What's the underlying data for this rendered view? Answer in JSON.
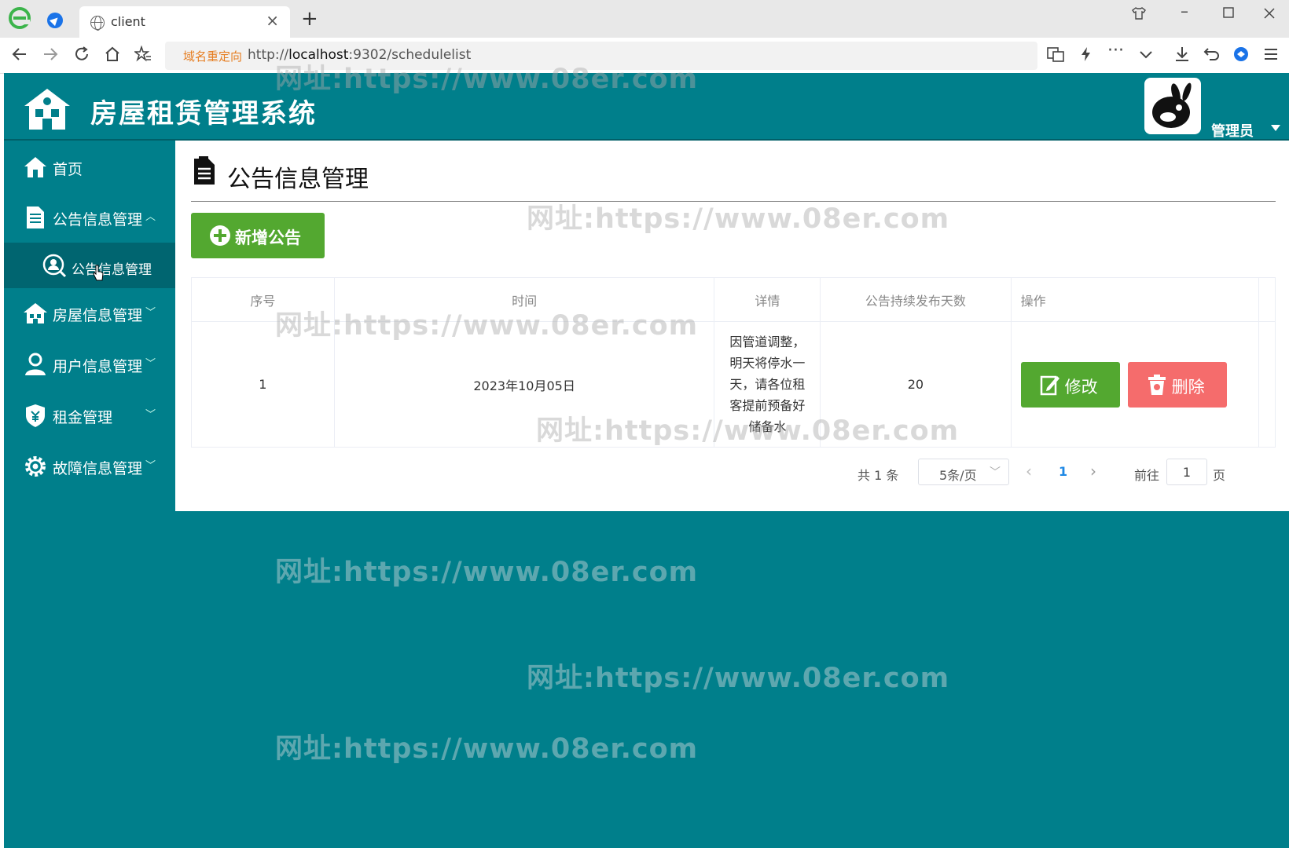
{
  "browser": {
    "tab_title": "client",
    "new_tab": "+",
    "close_tab": "×",
    "redirect_label": "域名重定向",
    "url_prefix": "http://",
    "url_host": "localhost",
    "url_rest": ":9302/schedulelist"
  },
  "header": {
    "system_title": "房屋租赁管理系统",
    "admin_name": "管理员"
  },
  "sidebar": {
    "items": [
      {
        "label": "首页",
        "icon": "home-icon"
      },
      {
        "label": "公告信息管理",
        "icon": "document-icon",
        "expanded": true
      },
      {
        "label": "公告信息管理",
        "icon": "search-person-icon",
        "active": true
      },
      {
        "label": "房屋信息管理",
        "icon": "house-icon"
      },
      {
        "label": "用户信息管理",
        "icon": "user-icon"
      },
      {
        "label": "租金管理",
        "icon": "shield-money-icon"
      },
      {
        "label": "故障信息管理",
        "icon": "gear-icon"
      }
    ],
    "arrow_up": "︿",
    "arrow_down": "﹀"
  },
  "main": {
    "page_title": "公告信息管理",
    "add_button": "新增公告",
    "table": {
      "headers": [
        "序号",
        "时间",
        "详情",
        "公告持续发布天数",
        "操作"
      ],
      "rows": [
        {
          "index": "1",
          "time": "2023年10月05日",
          "detail": "因管道调整，明天将停水一天，请各位租客提前预备好储备水",
          "days": "20"
        }
      ],
      "edit_label": "修改",
      "delete_label": "删除"
    },
    "pagination": {
      "total": "共 1 条",
      "page_size": "5条/页",
      "current_page": "1",
      "goto_label": "前往",
      "goto_value": "1",
      "page_suffix": "页"
    }
  },
  "watermark": "网址:https://www.08er.com",
  "colors": {
    "teal": "#007f8b",
    "green_button": "#53a830",
    "red_button": "#f56c6c",
    "pager_active": "#1e88e5"
  }
}
